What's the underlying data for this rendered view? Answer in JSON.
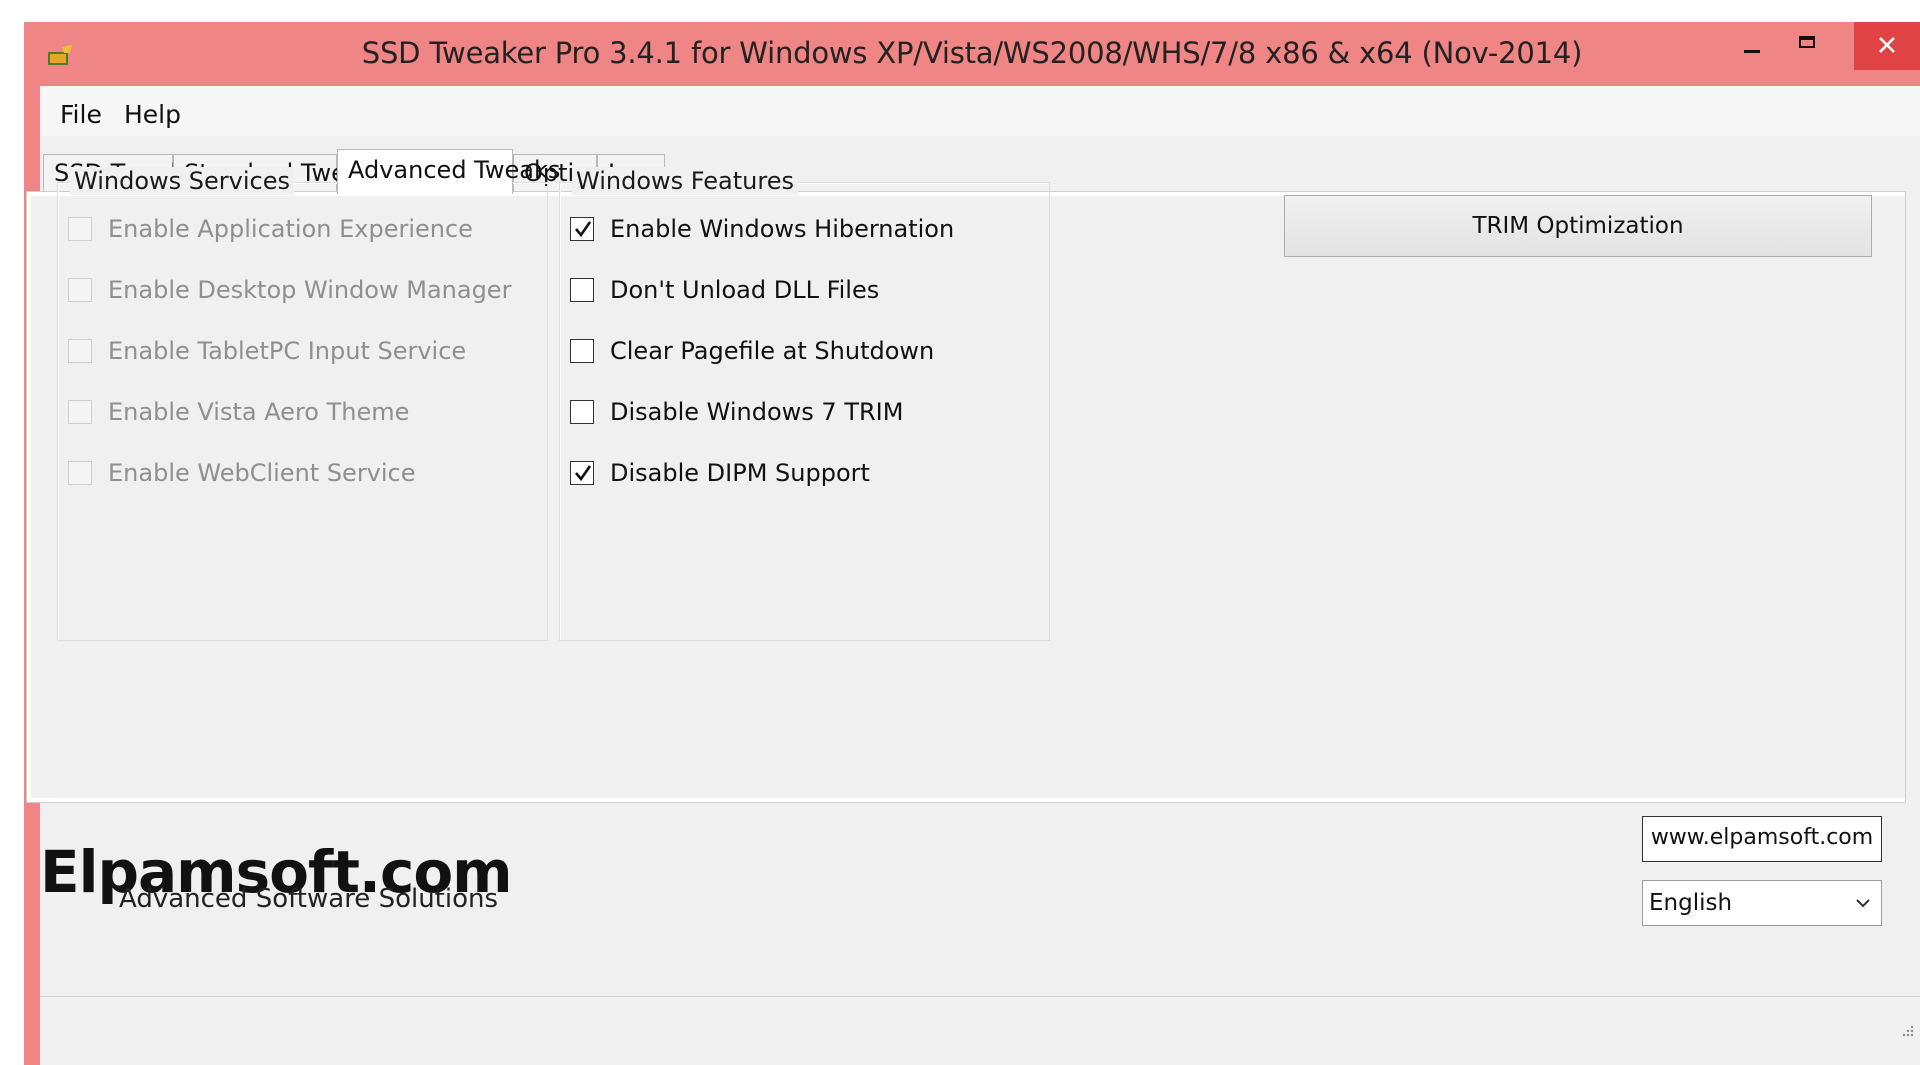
{
  "window": {
    "title": "SSD Tweaker Pro 3.4.1 for Windows XP/Vista/WS2008/WHS/7/8 x86 & x64 (Nov-2014)",
    "accent_color": "#ef8585",
    "close_color": "#e04343"
  },
  "menu": {
    "file": "File",
    "help": "Help"
  },
  "tabs": [
    "SSD Tweaker",
    "Standard Tweaks",
    "Advanced Tweaks",
    "Options",
    "Log"
  ],
  "active_tab": "Advanced Tweaks",
  "windows_services": {
    "title": "Windows Services",
    "items": [
      {
        "label": "Enable Application Experience",
        "checked": false,
        "enabled": false
      },
      {
        "label": "Enable Desktop Window Manager",
        "checked": false,
        "enabled": false
      },
      {
        "label": "Enable TabletPC Input Service",
        "checked": false,
        "enabled": false
      },
      {
        "label": "Enable Vista Aero Theme",
        "checked": false,
        "enabled": false
      },
      {
        "label": "Enable WebClient Service",
        "checked": false,
        "enabled": false
      }
    ]
  },
  "windows_features": {
    "title": "Windows Features",
    "items": [
      {
        "label": "Enable Windows Hibernation",
        "checked": true,
        "enabled": true
      },
      {
        "label": "Don't Unload DLL Files",
        "checked": false,
        "enabled": true
      },
      {
        "label": "Clear Pagefile at Shutdown",
        "checked": false,
        "enabled": true
      },
      {
        "label": "Disable Windows 7 TRIM",
        "checked": false,
        "enabled": true
      },
      {
        "label": "Disable DIPM Support",
        "checked": true,
        "enabled": true
      }
    ]
  },
  "trim_button": "TRIM Optimization",
  "logo": {
    "main": "Elpamsoft.com",
    "tagline": "Advanced Software Solutions"
  },
  "website": "www.elpamsoft.com",
  "language": "English",
  "icons": {
    "app": "app-icon",
    "minimize": "minimize-icon",
    "maximize": "maximize-icon",
    "close": "close-icon",
    "check": "checkmark-icon",
    "dropdown": "chevron-down-icon"
  }
}
